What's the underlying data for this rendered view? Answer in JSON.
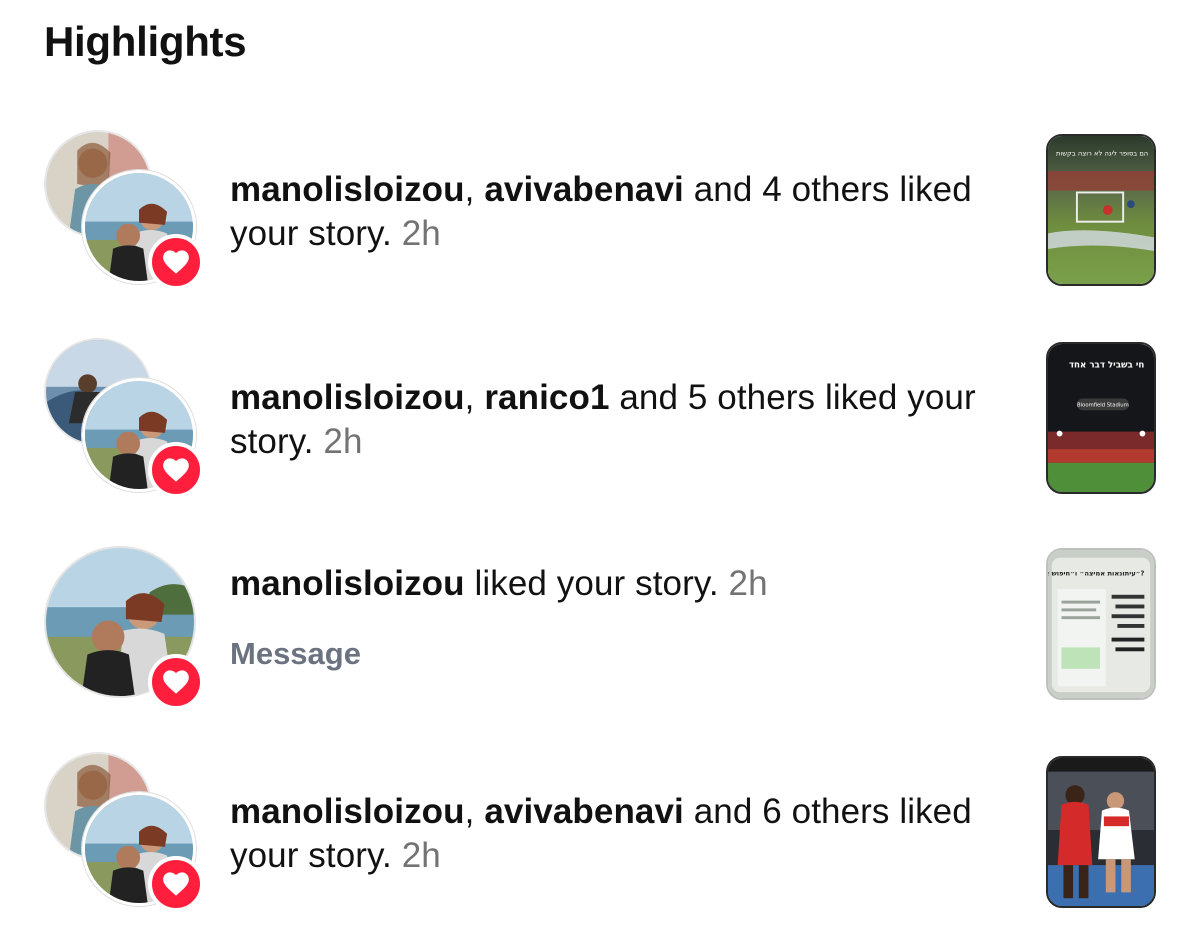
{
  "section": {
    "title": "Highlights"
  },
  "notifications": [
    {
      "users": [
        "manolisloizou",
        "avivabenavi"
      ],
      "sep": ", ",
      "tail": " and 4 others liked your story.",
      "time": "2h",
      "thumbnail": "story-thumbnail-soccer-goal",
      "thumb_text": "הם בסופר ליגה לא רוצה בקשות"
    },
    {
      "users": [
        "manolisloizou",
        "ranico1"
      ],
      "sep": ", ",
      "tail": " and 5 others liked your story.",
      "time": "2h",
      "thumbnail": "story-thumbnail-stadium-night",
      "thumb_text": "חי בשביל דבר אחד",
      "thumb_pill": "Bloomfield Stadium"
    },
    {
      "users": [
        "manolisloizou"
      ],
      "tail": " liked your story.",
      "time": "2h",
      "action": "Message",
      "thumbnail": "story-thumbnail-text-post",
      "thumb_text": "״עיתונאות אמיצה״ ו״חיפוש אמת״?"
    },
    {
      "users": [
        "manolisloizou",
        "avivabenavi"
      ],
      "sep": ", ",
      "tail": " and 6 others liked your story.",
      "time": "2h",
      "thumbnail": "story-thumbnail-players"
    }
  ],
  "colors": {
    "heart_badge": "#ff1f3d",
    "timestamp": "#737373",
    "message_link": "#6b7280"
  },
  "icons": {
    "badge": "heart-icon"
  }
}
